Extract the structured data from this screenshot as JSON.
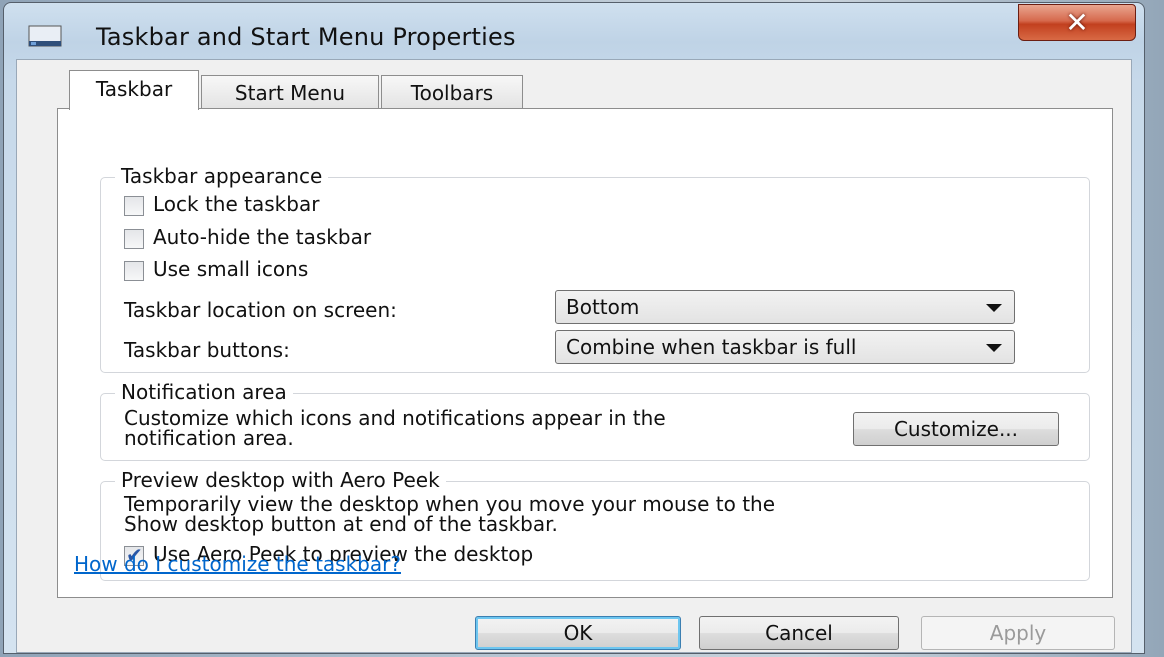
{
  "window": {
    "title": "Taskbar and Start Menu Properties",
    "close_glyph": "✕"
  },
  "tabs": [
    {
      "label": "Taskbar",
      "active": true
    },
    {
      "label": "Start Menu",
      "active": false
    },
    {
      "label": "Toolbars",
      "active": false
    }
  ],
  "appearance": {
    "title": "Taskbar appearance",
    "lock_label": "Lock the taskbar",
    "lock_checked": false,
    "autohide_label": "Auto-hide the taskbar",
    "autohide_checked": false,
    "small_icons_label": "Use small icons",
    "small_icons_checked": false,
    "location_label": "Taskbar location on screen:",
    "location_value": "Bottom",
    "buttons_label": "Taskbar buttons:",
    "buttons_value": "Combine when taskbar is full"
  },
  "notification": {
    "title": "Notification area",
    "desc_line1": "Customize which icons and notifications appear in the",
    "desc_line2": "notification area.",
    "customize_button": "Customize..."
  },
  "peek": {
    "title": "Preview desktop with Aero Peek",
    "desc_line1": "Temporarily view the desktop when you move your mouse to the",
    "desc_line2": "Show desktop button at end of the taskbar.",
    "checkbox_label": "Use Aero Peek to preview the desktop",
    "checked": true
  },
  "help_link": "How do I customize the taskbar?",
  "footer": {
    "ok": "OK",
    "cancel": "Cancel",
    "apply": "Apply"
  },
  "icons": {
    "window_icon": "taskbar-icon",
    "check_glyph": "✔"
  }
}
